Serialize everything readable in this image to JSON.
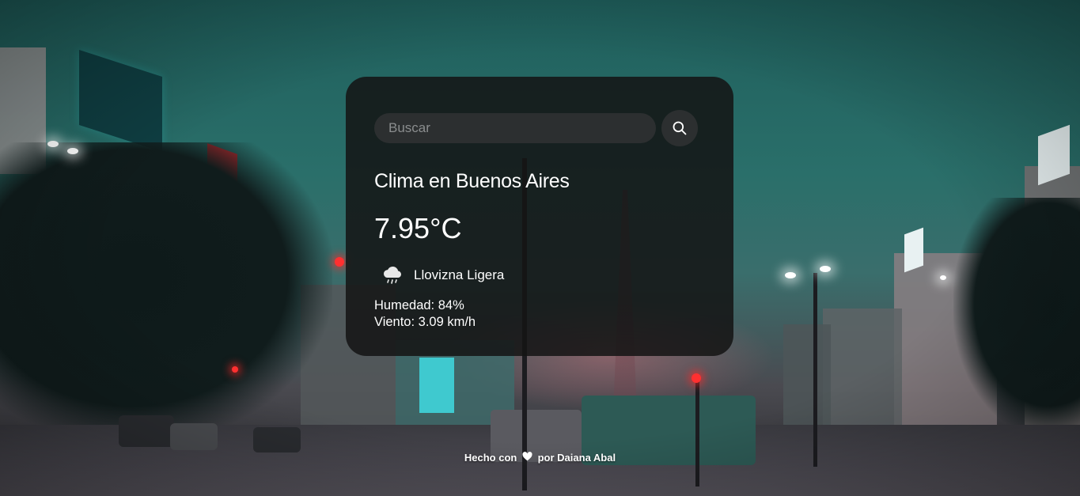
{
  "search": {
    "placeholder": "Buscar",
    "value": "",
    "button_icon": "search-icon"
  },
  "weather": {
    "title": "Clima en Buenos Aires",
    "temperature": "7.95°C",
    "icon": "cloud-drizzle-icon",
    "description": "Llovizna Ligera",
    "humidity": "Humedad: 84%",
    "wind": "Viento: 3.09 km/h"
  },
  "footer": {
    "prefix": "Hecho con",
    "heart_icon": "heart-icon",
    "suffix": "por Daiana Abal"
  },
  "colors": {
    "card_background": "#141414",
    "input_background": "#2c2f30",
    "text": "#ffffff",
    "placeholder": "#8a8d8e"
  }
}
